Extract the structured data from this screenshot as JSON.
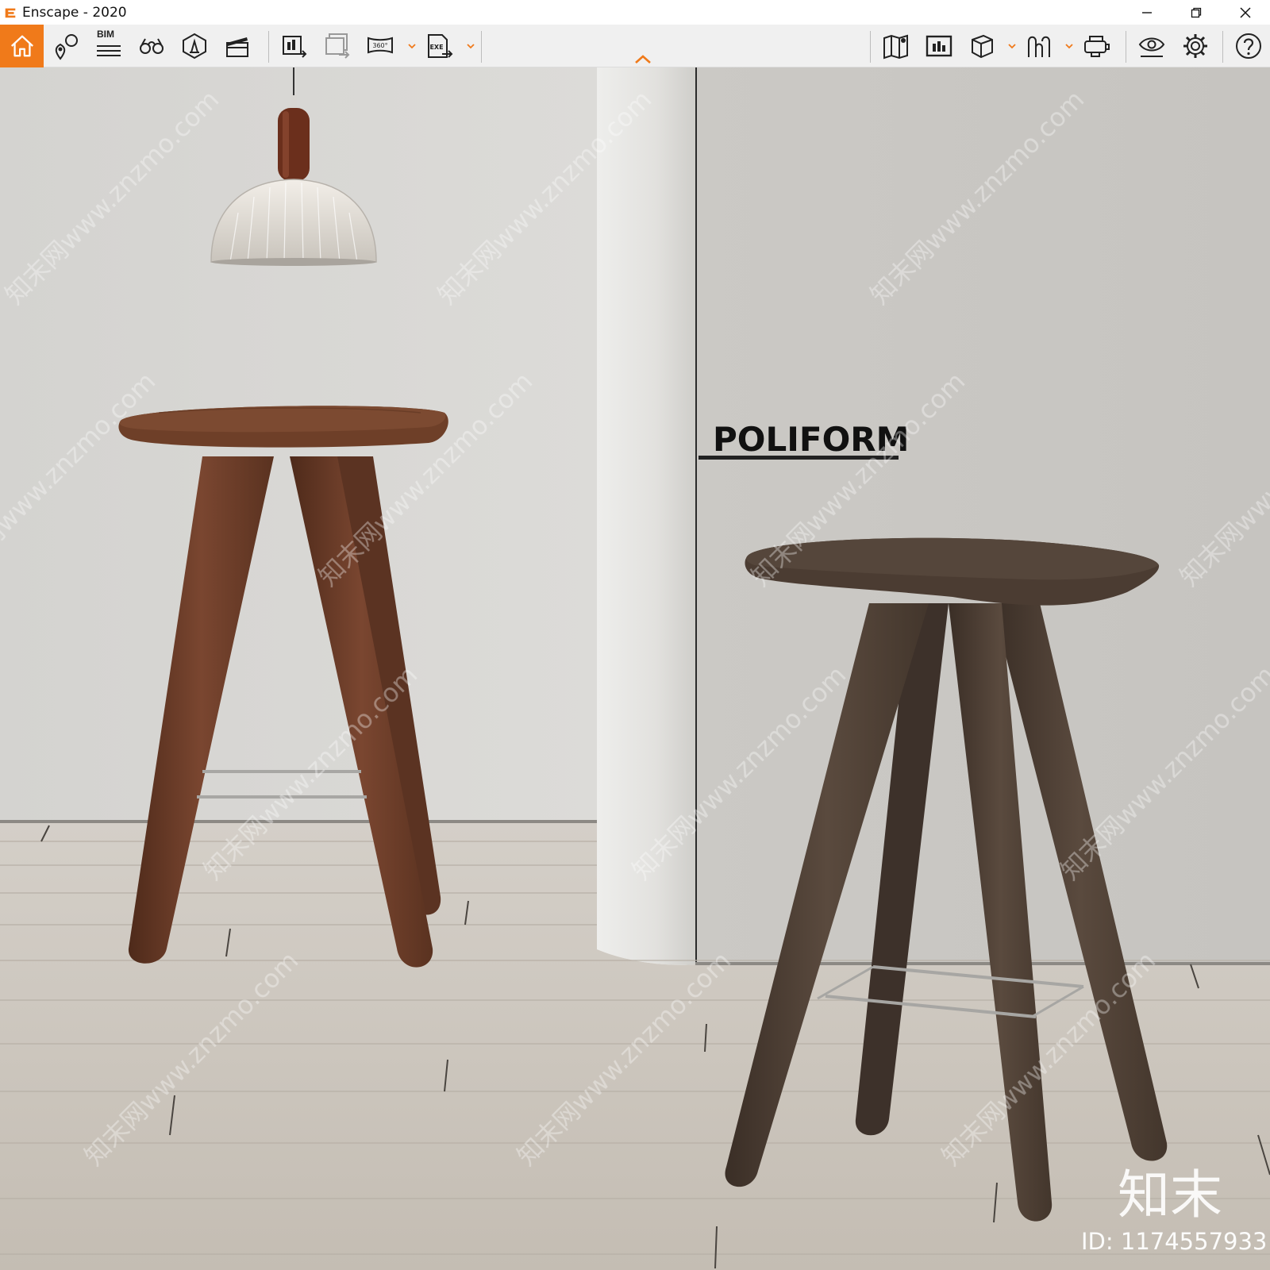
{
  "window": {
    "title": "Enscape - 2020"
  },
  "toolbar": {
    "bim_label": "BIM",
    "panorama_label": "360°",
    "exe_label": "EXE"
  },
  "scene": {
    "brand_text": "POLIFORM",
    "watermark_logo": "知末",
    "watermark_id": "ID: 1174557933",
    "watermark_repeat": "知末网www.znzmo.com"
  },
  "colors": {
    "accent": "#f07a1a",
    "wall": "#d6d5d2",
    "floor": "#c9c2b8",
    "stool_left": "#6e3f28",
    "stool_right": "#4b3c32"
  },
  "icons": [
    "home-icon",
    "location-pin-icon",
    "bim-list-icon",
    "binoculars-icon",
    "asset-library-icon",
    "clapperboard-icon",
    "render-export-icon",
    "batch-render-icon",
    "panorama-icon",
    "exe-export-icon",
    "map-icon",
    "minimap-icon",
    "box-view-icon",
    "walk-mode-icon",
    "vr-headset-icon",
    "visual-settings-icon",
    "gear-icon",
    "help-icon"
  ]
}
